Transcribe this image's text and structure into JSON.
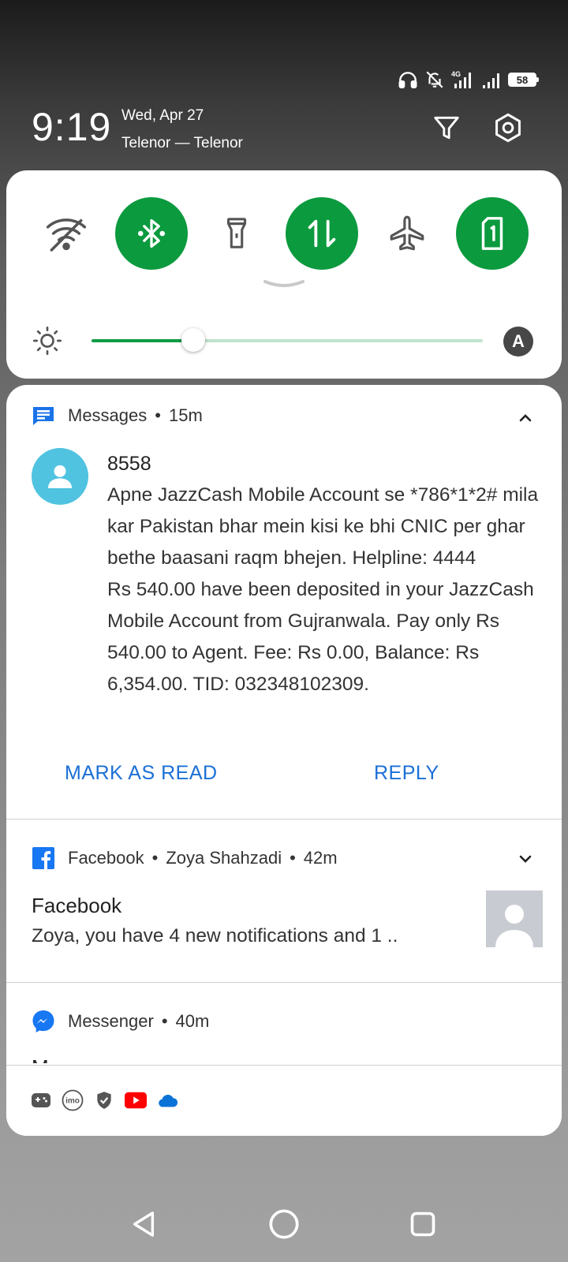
{
  "status_bar": {
    "battery_level": "58",
    "network_type": "4G"
  },
  "header": {
    "time": "9:19",
    "date": "Wed, Apr 27",
    "carrier": "Telenor — Telenor"
  },
  "quick_settings": {
    "tiles": [
      {
        "name": "wifi",
        "state": "off"
      },
      {
        "name": "bluetooth",
        "state": "on"
      },
      {
        "name": "flashlight",
        "state": "off"
      },
      {
        "name": "mobile-data",
        "state": "on"
      },
      {
        "name": "airplane-mode",
        "state": "off"
      },
      {
        "name": "sim-1",
        "state": "on"
      }
    ],
    "brightness_fraction": 0.26,
    "auto_brightness_label": "A",
    "accent_color": "#0b9a3e"
  },
  "notifications": {
    "messages": {
      "app": "Messages",
      "time": "15m",
      "sender": "8558",
      "body_1": "Apne JazzCash Mobile Account se *786*1*2# mila kar Pakistan bhar mein kisi ke bhi CNIC per ghar bethe baasani raqm bhejen. Helpline: 4444",
      "body_2": "Rs 540.00 have been deposited in your JazzCash Mobile Account from Gujranwala. Pay only Rs 540.00 to Agent. Fee: Rs 0.00, Balance: Rs 6,354.00. TID: 032348102309.",
      "action_mark_read": "MARK AS READ",
      "action_reply": "REPLY"
    },
    "facebook": {
      "app": "Facebook",
      "account": "Zoya Shahzadi",
      "time": "42m",
      "title": "Facebook",
      "text": "Zoya, you have 4 new notifications and 1 .."
    },
    "messenger": {
      "app": "Messenger",
      "time": "40m",
      "partial_title": "M"
    }
  },
  "bottom_apps": [
    "game-icon",
    "imo-icon",
    "shield-icon",
    "youtube-icon",
    "cloud-icon"
  ],
  "nav": [
    "back",
    "home",
    "recents"
  ]
}
